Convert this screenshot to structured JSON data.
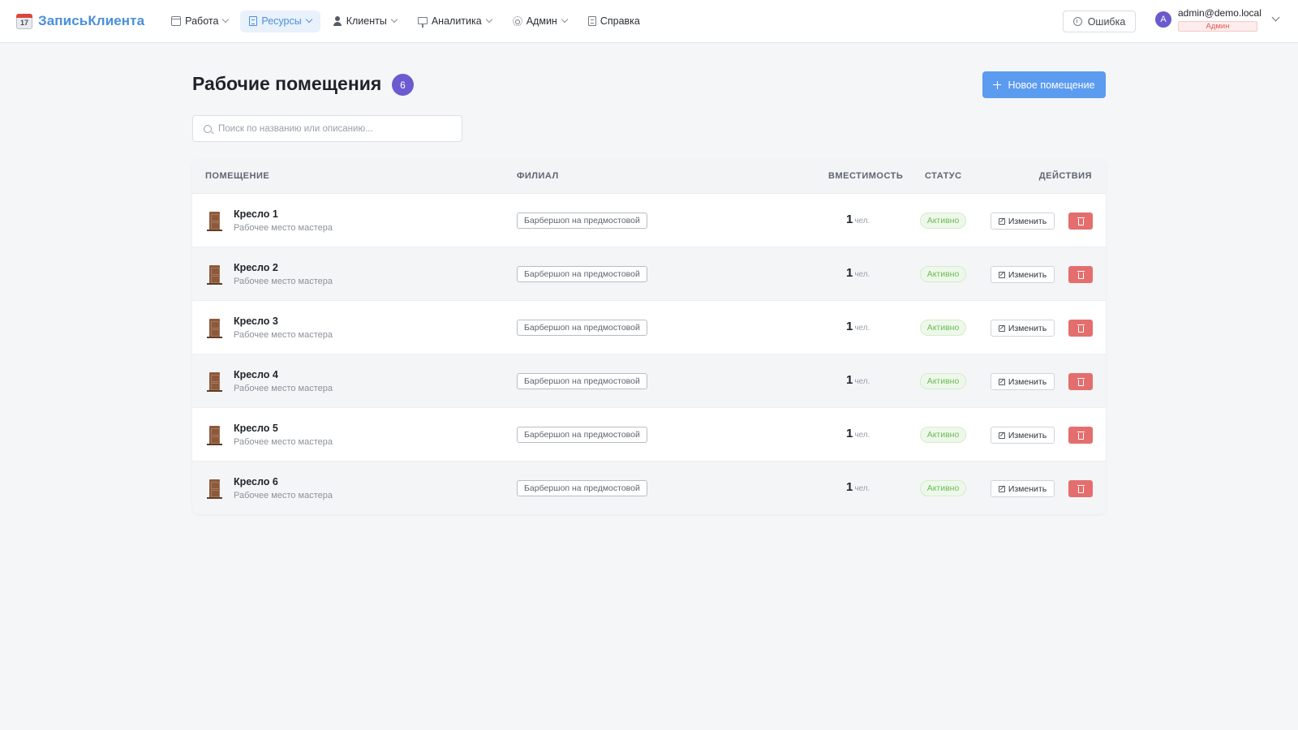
{
  "app": {
    "title": "ЗаписьКлиента",
    "logo_day": "17"
  },
  "nav": [
    {
      "label": "Работа",
      "icon": "calendar-icon",
      "active": false
    },
    {
      "label": "Ресурсы",
      "icon": "building-icon",
      "active": true
    },
    {
      "label": "Клиенты",
      "icon": "user-icon",
      "active": false
    },
    {
      "label": "Аналитика",
      "icon": "chart-icon",
      "active": false
    },
    {
      "label": "Админ",
      "icon": "gear-icon",
      "active": false
    },
    {
      "label": "Справка",
      "icon": "document-icon",
      "active": false
    }
  ],
  "header": {
    "error_label": "Ошибка",
    "user": {
      "avatar_letter": "A",
      "email": "admin@demo.local",
      "role": "Админ"
    }
  },
  "page": {
    "title": "Рабочие помещения",
    "count": "6",
    "new_button": "Новое помещение",
    "search_placeholder": "Поиск по названию или описанию..."
  },
  "table": {
    "headers": {
      "room": "ПОМЕЩЕНИЕ",
      "branch": "ФИЛИАЛ",
      "capacity": "ВМЕСТИМОСТЬ",
      "status": "СТАТУС",
      "actions": "ДЕЙСТВИЯ"
    },
    "edit_label": "Изменить",
    "rows": [
      {
        "name": "Кресло 1",
        "description": "Рабочее место мастера",
        "branch": "Барбершоп на предмостовой",
        "capacity": "1",
        "unit": "чел.",
        "status": "Активно"
      },
      {
        "name": "Кресло 2",
        "description": "Рабочее место мастера",
        "branch": "Барбершоп на предмостовой",
        "capacity": "1",
        "unit": "чел.",
        "status": "Активно"
      },
      {
        "name": "Кресло 3",
        "description": "Рабочее место мастера",
        "branch": "Барбершоп на предмостовой",
        "capacity": "1",
        "unit": "чел.",
        "status": "Активно"
      },
      {
        "name": "Кресло 4",
        "description": "Рабочее место мастера",
        "branch": "Барбершоп на предмостовой",
        "capacity": "1",
        "unit": "чел.",
        "status": "Активно"
      },
      {
        "name": "Кресло 5",
        "description": "Рабочее место мастера",
        "branch": "Барбершоп на предмостовой",
        "capacity": "1",
        "unit": "чел.",
        "status": "Активно"
      },
      {
        "name": "Кресло 6",
        "description": "Рабочее место мастера",
        "branch": "Барбершоп на предмостовой",
        "capacity": "1",
        "unit": "чел.",
        "status": "Активно"
      }
    ]
  },
  "colors": {
    "accent": "#4a90d9",
    "primary_button": "#5b9bf0",
    "badge": "#6b5bd0",
    "danger": "#e46e6e",
    "success": "#6dba5a"
  }
}
